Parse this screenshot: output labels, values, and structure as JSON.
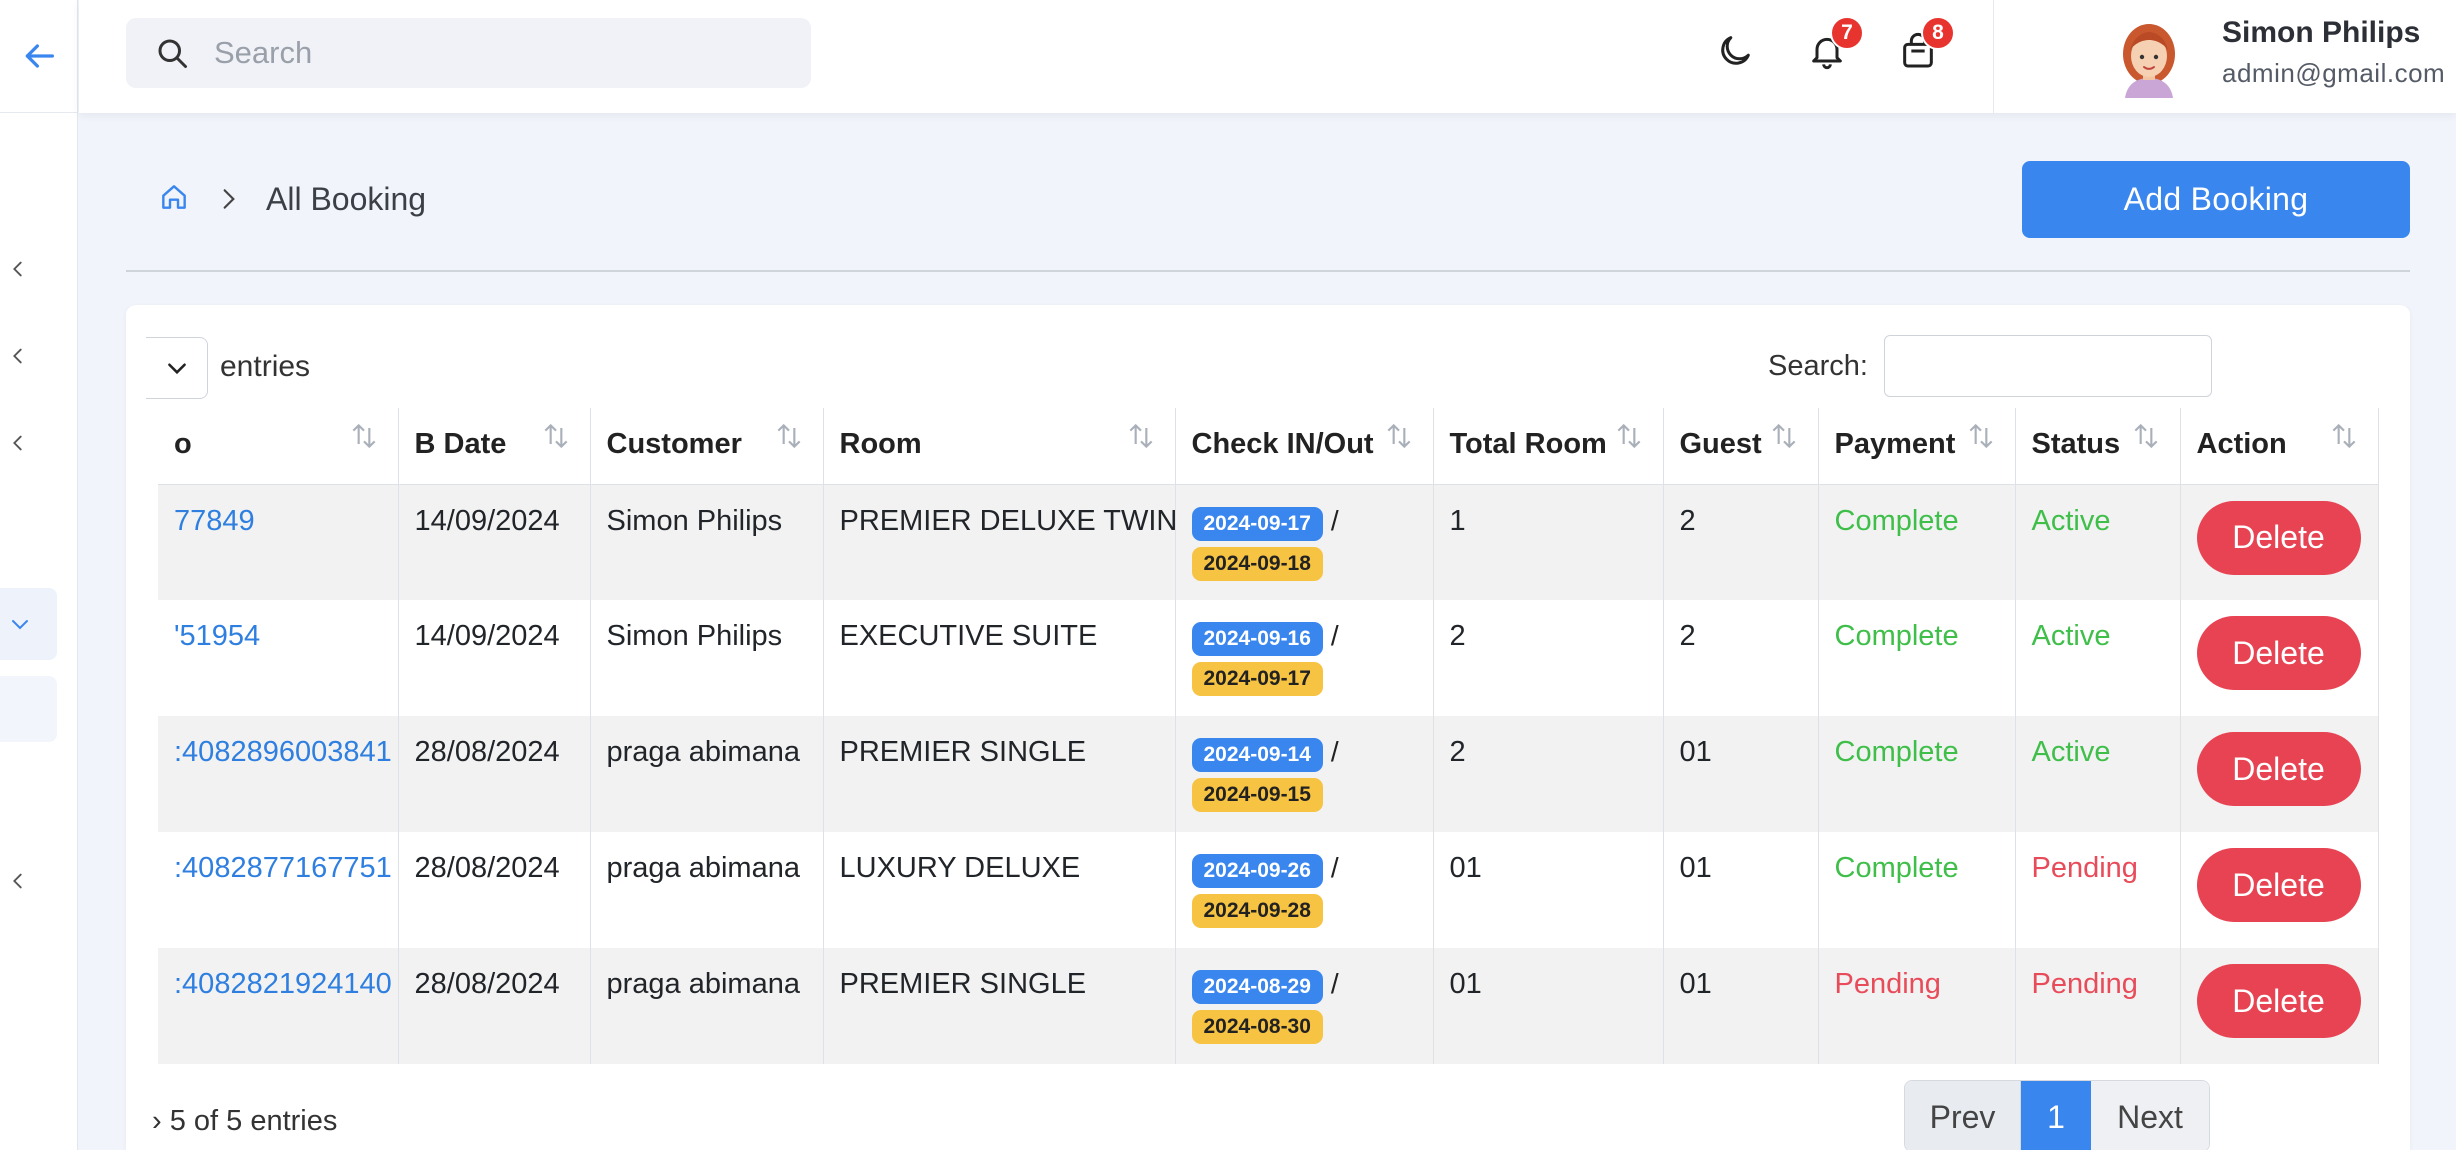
{
  "header": {
    "search_placeholder": "Search",
    "notifications_count": "7",
    "cart_count": "8",
    "user_name": "Simon Philips",
    "user_email": "admin@gmail.com"
  },
  "breadcrumb": {
    "current": "All Booking"
  },
  "toolbar": {
    "add_label": "Add Booking"
  },
  "table_controls": {
    "entries_label": "entries",
    "search_label": "Search:"
  },
  "columns": [
    "o",
    "B Date",
    "Customer",
    "Room",
    "Check IN/Out",
    "Total Room",
    "Guest",
    "Payment",
    "Status",
    "Action"
  ],
  "rows": [
    {
      "no": "77849",
      "date": "14/09/2024",
      "customer": "Simon Philips",
      "room": "PREMIER DELUXE TWIN",
      "check_in": "2024-09-17",
      "check_out": "2024-09-18",
      "total_room": "1",
      "guest": "2",
      "payment": "Complete",
      "status": "Active",
      "action": "Delete"
    },
    {
      "no": "'51954",
      "date": "14/09/2024",
      "customer": "Simon Philips",
      "room": "EXECUTIVE SUITE",
      "check_in": "2024-09-16",
      "check_out": "2024-09-17",
      "total_room": "2",
      "guest": "2",
      "payment": "Complete",
      "status": "Active",
      "action": "Delete"
    },
    {
      "no": ":4082896003841",
      "date": "28/08/2024",
      "customer": "praga abimana",
      "room": "PREMIER SINGLE",
      "check_in": "2024-09-14",
      "check_out": "2024-09-15",
      "total_room": "2",
      "guest": "01",
      "payment": "Complete",
      "status": "Active",
      "action": "Delete"
    },
    {
      "no": ":4082877167751",
      "date": "28/08/2024",
      "customer": "praga abimana",
      "room": "LUXURY DELUXE",
      "check_in": "2024-09-26",
      "check_out": "2024-09-28",
      "total_room": "01",
      "guest": "01",
      "payment": "Complete",
      "status": "Pending",
      "action": "Delete"
    },
    {
      "no": ":4082821924140",
      "date": "28/08/2024",
      "customer": "praga abimana",
      "room": "PREMIER SINGLE",
      "check_in": "2024-08-29",
      "check_out": "2024-08-30",
      "total_room": "01",
      "guest": "01",
      "payment": "Pending",
      "status": "Pending",
      "action": "Delete"
    }
  ],
  "footer": {
    "info": "› 5 of 5 entries",
    "prev": "Prev",
    "page": "1",
    "next": "Next"
  },
  "colors": {
    "primary": "#3a86ef",
    "danger": "#e84352",
    "success": "#3fbf4a",
    "checkout": "#f6c343"
  }
}
